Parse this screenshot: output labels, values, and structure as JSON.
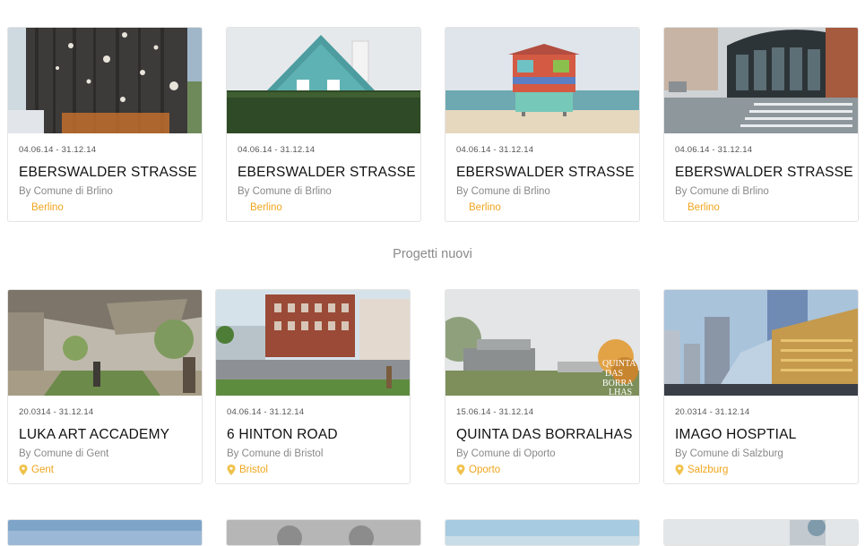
{
  "row1": [
    {
      "date": "04.06.14 - 31.12.14",
      "title": "EBERSWALDER STRASSE",
      "by": "By Comune di Brlino",
      "location": "Berlino",
      "show_pin": false
    },
    {
      "date": "04.06.14 - 31.12.14",
      "title": "EBERSWALDER STRASSE",
      "by": "By Comune di Brlino",
      "location": "Berlino",
      "show_pin": false
    },
    {
      "date": "04.06.14 - 31.12.14",
      "title": "EBERSWALDER STRASSE",
      "by": "By Comune di Brlino",
      "location": "Berlino",
      "show_pin": false
    },
    {
      "date": "04.06.14 - 31.12.14",
      "title": "EBERSWALDER STRASSE",
      "by": "By Comune di Brlino",
      "location": "Berlino",
      "show_pin": false
    }
  ],
  "section": {
    "heading": "Progetti nuovi"
  },
  "row2": [
    {
      "date": "20.0314 - 31.12.14",
      "title": "LUKA ART ACCADEMY",
      "by": "By Comune di Gent",
      "location": "Gent",
      "show_pin": true
    },
    {
      "date": "04.06.14 - 31.12.14",
      "title": "6 HINTON ROAD",
      "by": "By Comune di Bristol",
      "location": "Bristol",
      "show_pin": true
    },
    {
      "date": "15.06.14 - 31.12.14",
      "title": "QUINTA DAS BORRALHAS",
      "by": "By Comune di Oporto",
      "location": "Oporto",
      "show_pin": true
    },
    {
      "date": "20.0314 - 31.12.14",
      "title": "IMAGO HOSPTIAL",
      "by": "By Comune di Salzburg",
      "location": "Salzburg",
      "show_pin": true
    }
  ],
  "image_overlay_text": {
    "quinta": "QUINTA DAS BORRA LHAS"
  },
  "colors": {
    "accent": "#f0a51e",
    "border": "#e4e4e4",
    "title": "#111111",
    "muted": "#888888"
  }
}
